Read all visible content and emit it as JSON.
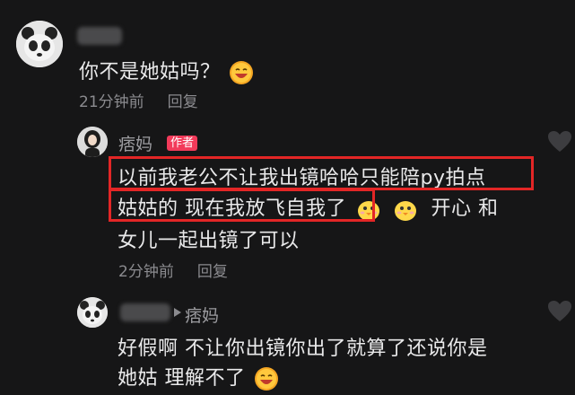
{
  "comments": [
    {
      "author": "",
      "text": "你不是她姑吗？",
      "time": "21分钟前",
      "reply_label": "回复"
    },
    {
      "author": "痞妈",
      "author_tag": "作者",
      "lines": [
        "以前我老公不让我出镜哈哈只能陪py拍点",
        "姑姑的 现在我放飞自我了",
        "开心 和",
        "女儿一起出镜了可以"
      ],
      "time": "2分钟前",
      "reply_label": "回复"
    },
    {
      "author": "",
      "reply_to": "痞妈",
      "lines": [
        "好假啊 不让你出镜你出了就算了还说你是",
        "她姑 理解不了"
      ]
    }
  ],
  "icons": {
    "reply_arrow": "triangle-right-icon",
    "like": "heart-icon",
    "emoji_grin": "grinning-emoji-icon",
    "emoji_chick": "chick-emoji-icon"
  },
  "colors": {
    "highlight": "#e32626",
    "author_tag": "#f23a5a",
    "background": "#161617"
  }
}
